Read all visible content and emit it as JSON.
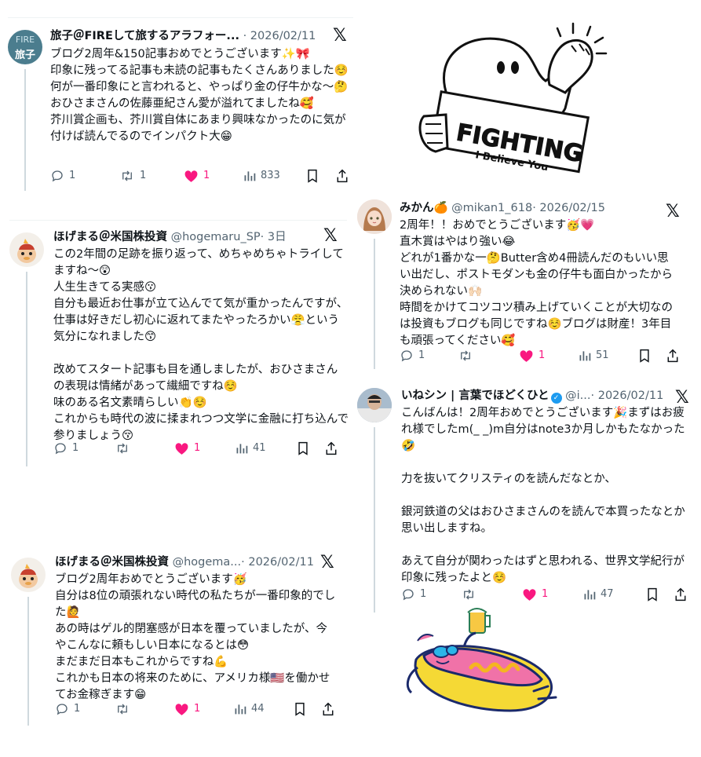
{
  "tweets": [
    {
      "author": "旅子＠FIREして旅するアラフォー...",
      "handle": "",
      "date": "· 2026/02/11",
      "avatar_text_1": "FIRE",
      "avatar_text_2": "旅子",
      "body": "ブログ2周年&150記事おめでとうございます✨🎀\n印象に残ってる記事も未読の記事もたくさんありました☺️何が一番印象にと言われると、やっぱり金の仔牛かな〜🤔おひさまさんの佐藤亜紀さん愛が溢れてましたね🥰\n芥川賞企画も、芥川賞自体にあまり興味なかったのに気が付けば読んでるのでインパクト大😁",
      "replies": "1",
      "retweets": "1",
      "likes": "1",
      "views": "833"
    },
    {
      "author": "ほげまる＠米国株投資",
      "handle": "@hogemaru_SP",
      "date": "· 3日",
      "body": "この2年間の足跡を振り返って、めちゃめちゃトライしてますね〜😲\n人生生きてる実感😗\n自分も最近お仕事が立て込んでて気が重かったんですが、仕事は好きだし初心に返れてまたやったろかい😤という気分になれました😙\n\n改めてスタート記事も目を通しましたが、おひさまさんの表現は情緒があって繊細ですね☺️\n味のある名文素晴らしい👏☺️\nこれからも時代の波に揉まれつつ文学に金融に打ち込んで参りましょう😚",
      "replies": "1",
      "retweets": "",
      "likes": "1",
      "views": "41"
    },
    {
      "author": "みかん🍊",
      "handle": "@mikan1_618",
      "date": "· 2026/02/15",
      "body": "2周年！！おめでとうございます🥳💗\n直木賞はやはり強い😂\nどれが1番かな一🤔Butter含め4冊読んだのもいい思い出だし、ポストモダンも金の仔牛も面白かったから決められない🙌🏻\n時間をかけてコツコツ積み上げていくことが大切なのは投資もブログも同じですね☺️ブログは財産！3年目も頑張ってください🥰",
      "replies": "1",
      "retweets": "",
      "likes": "1",
      "views": "51"
    },
    {
      "author": "いねシン | 言葉でほどくひと",
      "handle": "@i...",
      "date": "· 2026/02/11",
      "body": "こんばんは！2周年おめでとうございます🎉まずはお疲れ様でしたm(_ _)m自分はnote3か月しかもたなかった🤣\n\n力を抜いてクリスティのを読んだなとか、\n\n銀河鉄道の父はおひさまさんのを読んで本買ったなとか思い出しますね。\n\nあえて自分が関わったはずと思われる、世界文学紀行が印象に残ったよと☺️",
      "replies": "1",
      "retweets": "",
      "likes": "1",
      "views": "47"
    },
    {
      "author": "ほげまる＠米国株投資",
      "handle": "@hogema...",
      "date": "· 2026/02/11",
      "body": "ブログ2周年おめでとうございます🥳\n自分は8位の頑張れない時代の私たちが一番印象的でした🙋\nあの時はゲル的閉塞感が日本を覆っていましたが、今やこんなに頼もしい日本になるとは😳\nまだまだ日本もこれからですね💪\nこれかも日本の将来のために、アメリカ様🇺🇸を働かせてお金稼ぎます😁",
      "replies": "1",
      "retweets": "",
      "likes": "1",
      "views": "44"
    }
  ],
  "sticker_fighting": {
    "line1": "FIGHTING",
    "line2": "I Believe You"
  },
  "icons": {
    "platform": "x-logo-icon",
    "reply": "reply-icon",
    "retweet": "retweet-icon",
    "like": "heart-icon",
    "views": "views-icon",
    "bookmark": "bookmark-icon",
    "share": "share-icon"
  },
  "colors": {
    "like": "#f91880",
    "muted": "#536471",
    "verified": "#1d9bf0"
  }
}
